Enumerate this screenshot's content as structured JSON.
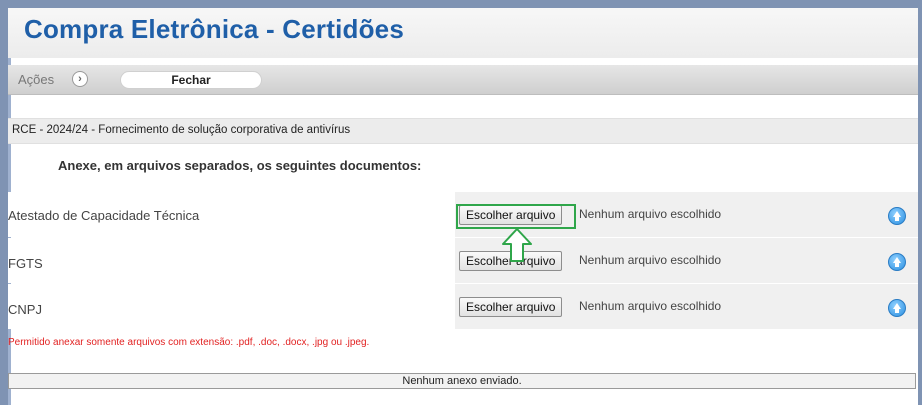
{
  "header": {
    "title": "Compra Eletrônica - Certidões"
  },
  "toolbar": {
    "acoes_label": "Ações",
    "acoes_arrow": "›",
    "close_label": "Fechar"
  },
  "process": {
    "description": "RCE - 2024/24 - Fornecimento de solução corporativa de antivírus"
  },
  "instruction": "Anexe, em arquivos separados, os seguintes documentos:",
  "documents": [
    {
      "label": "Atestado de Capacidade Técnica",
      "button": "Escolher arquivo",
      "status": "Nenhum arquivo escolhido",
      "icon": "upload-icon"
    },
    {
      "label": "FGTS",
      "button": "Escolher arquivo",
      "status": "Nenhum arquivo escolhido",
      "icon": "upload-icon"
    },
    {
      "label": "CNPJ",
      "button": "Escolher arquivo",
      "status": "Nenhum arquivo escolhido",
      "icon": "upload-icon"
    }
  ],
  "warning": "Permitido anexar somente arquivos com extensão: .pdf, .doc, .docx, .jpg ou .jpeg.",
  "footer": {
    "status": "Nenhum anexo enviado."
  },
  "colors": {
    "title": "#1f5fa8",
    "highlight": "#2fa64a",
    "warning": "#e22222"
  }
}
